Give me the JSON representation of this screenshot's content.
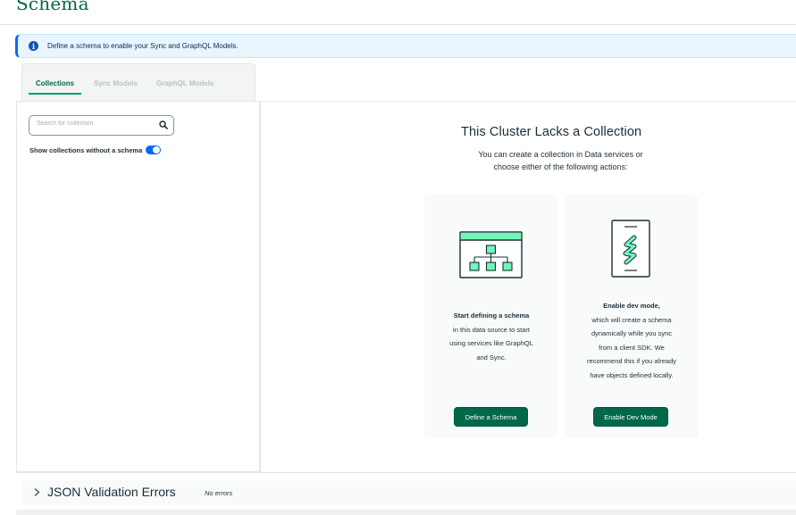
{
  "page": {
    "title": "Schema"
  },
  "banner": {
    "text": "Define a schema to enable your Sync and GraphQL Models.",
    "icon": "info-icon",
    "color": "#016bf8"
  },
  "tabs": [
    {
      "label": "Collections",
      "active": true
    },
    {
      "label": "Sync Models",
      "active": false
    },
    {
      "label": "GraphQL Models",
      "active": false
    }
  ],
  "sidebar": {
    "search_placeholder": "Search for collection",
    "toggle_label": "Show collections without a schema",
    "toggle_on": true
  },
  "main": {
    "heading": "This Cluster Lacks a Collection",
    "subheading_line1": "You can create a collection in Data services or",
    "subheading_line2": "choose either of the following actions:"
  },
  "cards": {
    "schema": {
      "title": "Start defining a schema",
      "line1": "in this data source to start",
      "line2": "using services like GraphQL",
      "line3": "and Sync.",
      "button": "Define a Schema",
      "icon": "schema-tree-icon"
    },
    "devmode": {
      "title": "Enable dev mode,",
      "line1": "which will create a schema",
      "line2": "dynamically while you sync",
      "line3": "from a client SDK. We",
      "line4": "recommend this if you already",
      "line5": "have objects defined locally.",
      "button": "Enable Dev Mode",
      "icon": "mobile-sync-icon"
    }
  },
  "validation": {
    "title": "JSON Validation Errors",
    "status": "No errors"
  },
  "colors": {
    "brand_green": "#00684a",
    "accent_green": "#00ed64",
    "info_blue": "#016bf8"
  }
}
